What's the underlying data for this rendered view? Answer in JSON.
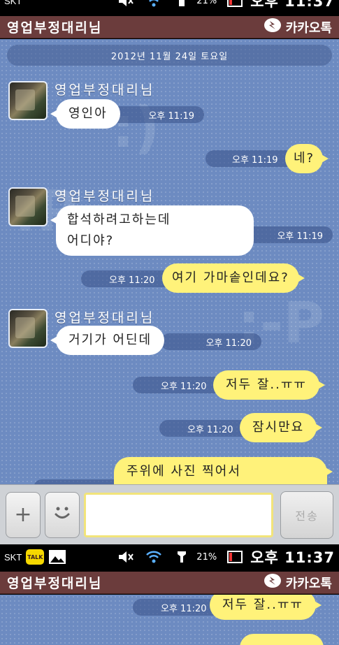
{
  "status_top": {
    "carrier": "SKT",
    "battery": "21%",
    "time": "오후 11:37"
  },
  "title_top": {
    "chat_name": "영업부정대리님",
    "brand": "카카오톡"
  },
  "chat": {
    "date": "2012년 11월 24일 토요일",
    "messages": [
      {
        "side": "left",
        "sender": "영업부정대리님",
        "text": "영인아",
        "time": "오후 11:19"
      },
      {
        "side": "right",
        "text": "네?",
        "time": "오후 11:19"
      },
      {
        "side": "left",
        "sender": "영업부정대리님",
        "text_line1": "합석하려고하는데",
        "text_line2": "어디야?",
        "time": "오후 11:19"
      },
      {
        "side": "right",
        "text": "여기 가마솥인데요?",
        "time": "오후 11:20"
      },
      {
        "side": "left",
        "sender": "영업부정대리님",
        "text": "거기가 어딘데",
        "time": "오후 11:20"
      },
      {
        "side": "right",
        "text": "저두 잘..ㅠㅠ",
        "time": "오후 11:20"
      },
      {
        "side": "right",
        "text": "잠시만요",
        "time": "오후 11:20"
      },
      {
        "side": "right",
        "text": "주위에 사진 찍어서",
        "time": ""
      }
    ]
  },
  "input": {
    "plus_label": "+",
    "send_label": "전송"
  },
  "status_bottom": {
    "carrier": "SKT",
    "battery": "21%",
    "time": "오후 11:37",
    "apps": [
      "TALK"
    ]
  },
  "title_bottom": {
    "chat_name": "영업부정대리님",
    "brand": "카카오톡"
  },
  "chat_bottom": {
    "messages": [
      {
        "side": "right",
        "text": "저두 잘..ㅠㅠ",
        "time": "오후 11:20"
      }
    ]
  },
  "colors": {
    "chat_bg": "#6d8bc1",
    "bubble_yellow": "#fff27a",
    "titlebar": "#6b3c3c"
  },
  "icons": [
    "mute-icon",
    "wifi-icon",
    "signal-icon",
    "battery-icon",
    "kakao-logo-icon",
    "plus-icon",
    "emoticon-icon",
    "talk-app-icon",
    "gallery-icon"
  ]
}
